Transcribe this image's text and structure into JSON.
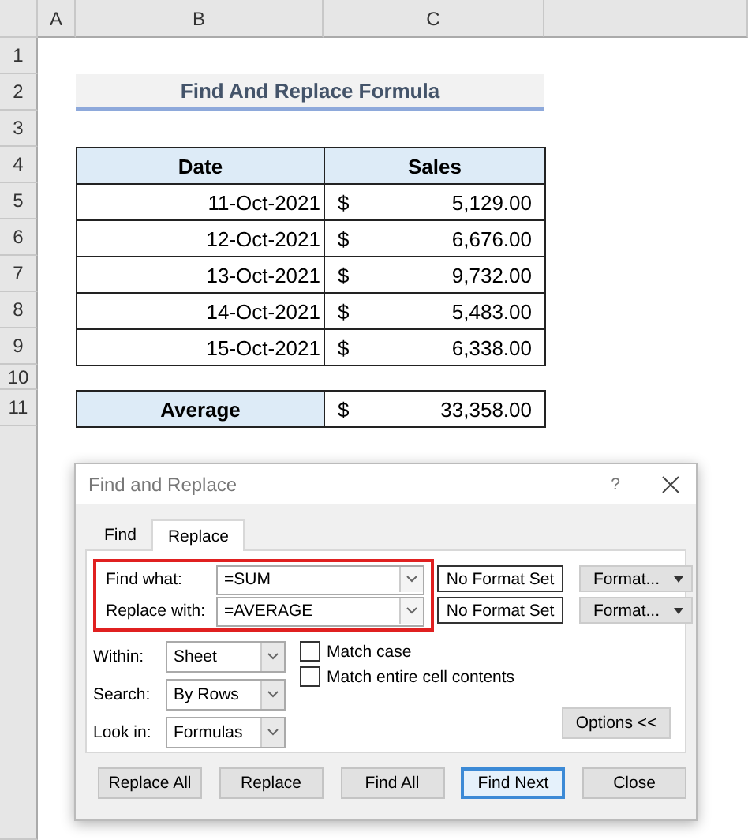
{
  "sheet": {
    "columns": [
      "A",
      "B",
      "C"
    ],
    "rows": [
      "1",
      "2",
      "3",
      "4",
      "5",
      "6",
      "7",
      "8",
      "9",
      "10",
      "11"
    ],
    "title": "Find And Replace Formula",
    "headers": [
      "Date",
      "Sales"
    ],
    "records": [
      {
        "date": "11-Oct-2021",
        "currency": "$",
        "sales": "5,129.00"
      },
      {
        "date": "12-Oct-2021",
        "currency": "$",
        "sales": "6,676.00"
      },
      {
        "date": "13-Oct-2021",
        "currency": "$",
        "sales": "9,732.00"
      },
      {
        "date": "14-Oct-2021",
        "currency": "$",
        "sales": "5,483.00"
      },
      {
        "date": "15-Oct-2021",
        "currency": "$",
        "sales": "6,338.00"
      }
    ],
    "summary": {
      "label": "Average",
      "currency": "$",
      "value": "33,358.00"
    }
  },
  "dialog": {
    "title": "Find and Replace",
    "help": "?",
    "tabs": [
      {
        "label": "Find",
        "selected": false
      },
      {
        "label": "Replace",
        "selected": true
      }
    ],
    "fields": [
      {
        "label": "Find what:",
        "value": "=SUM",
        "format_status": "No Format Set",
        "format_button": "Format..."
      },
      {
        "label": "Replace with:",
        "value": "=AVERAGE",
        "format_status": "No Format Set",
        "format_button": "Format..."
      }
    ],
    "options": [
      {
        "label": "Within:",
        "value": "Sheet"
      },
      {
        "label": "Search:",
        "value": "By Rows"
      },
      {
        "label": "Look in:",
        "value": "Formulas"
      }
    ],
    "checks": [
      {
        "label": "Match case",
        "checked": false
      },
      {
        "label": "Match entire cell contents",
        "checked": false
      }
    ],
    "options_button": "Options <<",
    "buttons": [
      {
        "label": "Replace All",
        "focused": false
      },
      {
        "label": "Replace",
        "focused": false
      },
      {
        "label": "Find All",
        "focused": false
      },
      {
        "label": "Find Next",
        "focused": true
      },
      {
        "label": "Close",
        "focused": false
      }
    ]
  }
}
